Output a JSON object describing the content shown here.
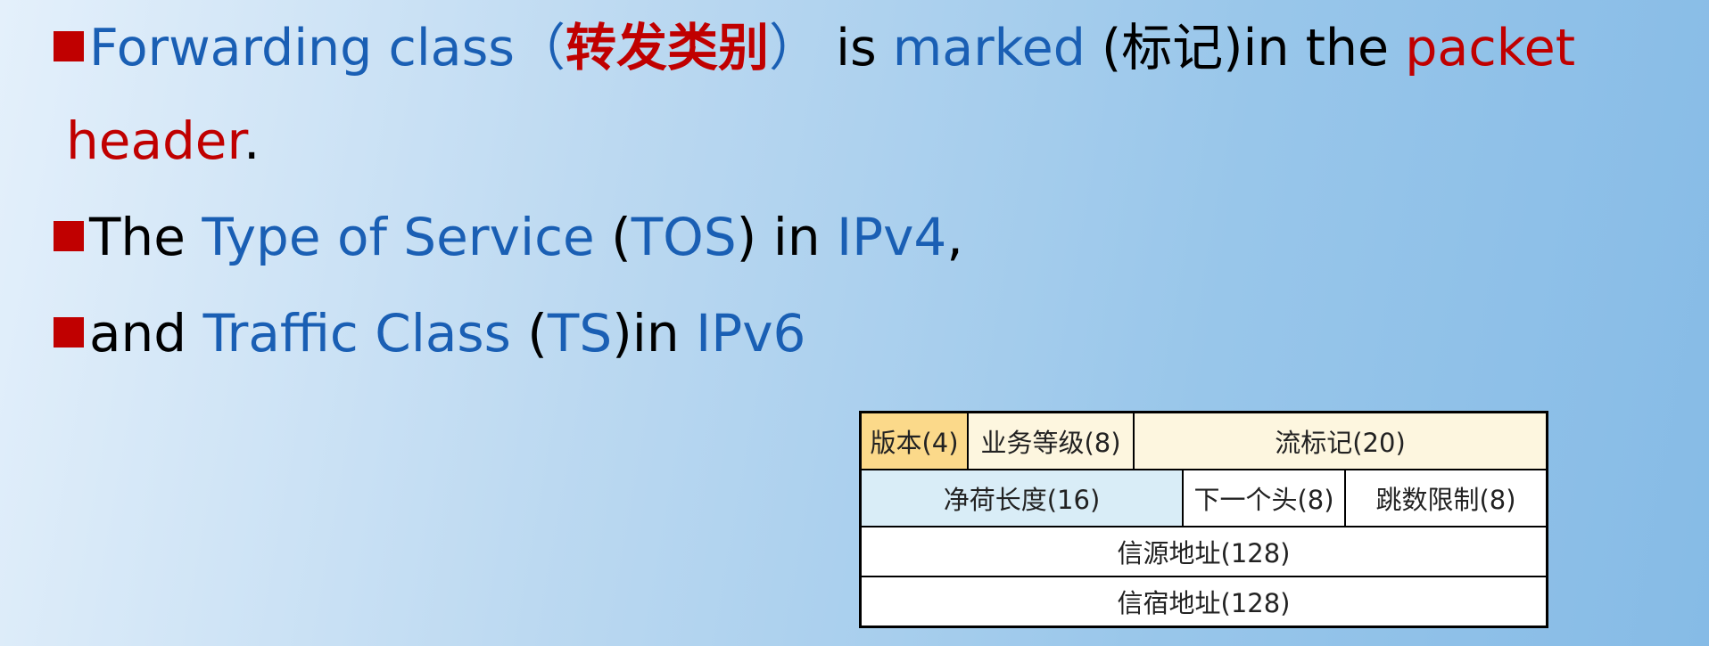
{
  "line1": {
    "bullet": "■",
    "t1": "Forwarding class",
    "t2": "（",
    "t3": "转发类别",
    "t4": "）",
    "t5": " is ",
    "t6": "marked",
    "t7": " (标记)in the ",
    "t8": "packet"
  },
  "line2": {
    "t1": "header",
    "t2": "."
  },
  "line3": {
    "t1": "The ",
    "t2": "Type of Service",
    "t3": " (",
    "t4": "TOS",
    "t5": ") in ",
    "t6": "IPv4",
    "t7": ","
  },
  "line4": {
    "t1": "and ",
    "t2": "Traffic Class",
    "t3": " (",
    "t4": "TS",
    "t5": ")in ",
    "t6": "IPv6"
  },
  "ipv6_header": {
    "version": "版本(4)",
    "traffic_class": "业务等级(8)",
    "flow_label": "流标记(20)",
    "payload_length": "净荷长度(16)",
    "next_header": "下一个头(8)",
    "hop_limit": "跳数限制(8)",
    "source_address": "信源地址(128)",
    "destination_address": "信宿地址(128)"
  },
  "colors": {
    "bullet": "#c00000",
    "blue_text": "#1a5fb4",
    "red_text": "#c00000",
    "version_cell": "#fbd98a",
    "cream_cell": "#fdf6df",
    "light_blue_cell": "#d9edf7"
  }
}
